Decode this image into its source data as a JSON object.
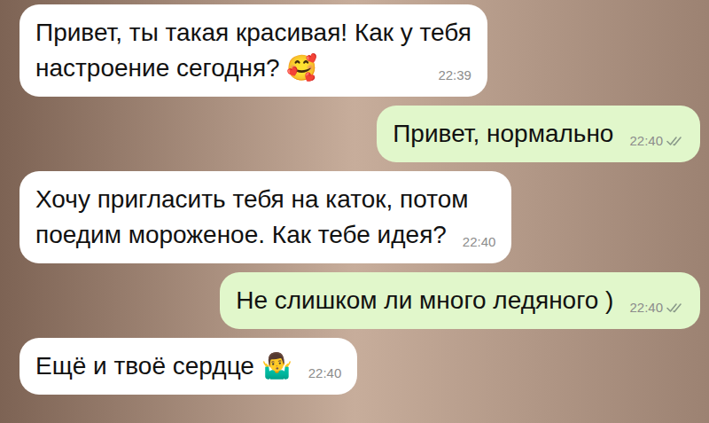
{
  "messages": [
    {
      "kind": "incoming",
      "lines": [
        "Привет, ты такая красивая! Как у тебя",
        "настроение сегодня? 🥰"
      ],
      "time": "22:39"
    },
    {
      "kind": "outgoing",
      "lines": [
        "Привет, нормально"
      ],
      "time": "22:40"
    },
    {
      "kind": "incoming",
      "lines": [
        "Хочу пригласить тебя на каток, потом",
        "поедим мороженое. Как тебе идея?"
      ],
      "time": "22:40"
    },
    {
      "kind": "outgoing",
      "lines": [
        "Не слишком ли много ледяного )"
      ],
      "time": "22:40"
    },
    {
      "kind": "incoming",
      "lines": [
        "Ещё и твоё сердце 🤷‍♂️"
      ],
      "time": "22:40"
    }
  ]
}
